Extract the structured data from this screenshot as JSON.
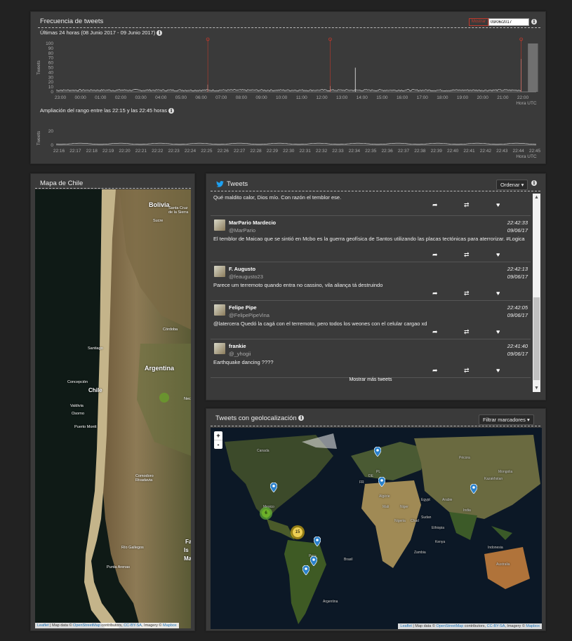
{
  "freq": {
    "title": "Frecuencia de tweets",
    "date_value": "09/06/2017",
    "date_btn": "Mostrar",
    "info": "i",
    "sub24": "Últimas 24 horas (08 Junio 2017 - 09 Junio 2017)",
    "y_ticks": [
      "100",
      "90",
      "80",
      "70",
      "60",
      "50",
      "40",
      "30",
      "20",
      "10",
      "0"
    ],
    "y_label": "Tweets",
    "x_ticks": [
      "23:00",
      "00:00",
      "01:00",
      "02:00",
      "03:00",
      "04:00",
      "05:00",
      "06:00",
      "07:00",
      "08:00",
      "09:00",
      "10:00",
      "11:00",
      "12:00",
      "13:00",
      "14:00",
      "15:00",
      "16:00",
      "17:00",
      "18:00",
      "19:00",
      "20:00",
      "21:00",
      "22:00"
    ],
    "x_unit": "Hora UTC",
    "sub_zoom": "Ampliación del rango entre las 22:15 y las 22:45 horas",
    "zoom_y_ticks": [
      "20",
      "0"
    ],
    "zoom_x_ticks": [
      "22:16",
      "22:17",
      "22:18",
      "22:19",
      "22:20",
      "22:21",
      "22:22",
      "22:23",
      "22:24",
      "22:25",
      "22:26",
      "22:27",
      "22:28",
      "22:29",
      "22:30",
      "22:31",
      "22:32",
      "22:33",
      "22:34",
      "22:35",
      "22:36",
      "22:37",
      "22:38",
      "22:39",
      "22:40",
      "22:41",
      "22:42",
      "22:43",
      "22:44",
      "22:45"
    ],
    "zoom_x_unit": "Hora UTC"
  },
  "chart_data": [
    {
      "type": "line",
      "title": "Últimas 24 horas (08 Junio 2017 - 09 Junio 2017)",
      "ylabel": "Tweets",
      "xlabel": "Hora UTC",
      "ylim": [
        0,
        100
      ],
      "series": [
        {
          "x": [
            "23:00",
            "03:00",
            "04:00",
            "07:00",
            "07:30",
            "08:00",
            "12:00",
            "13:00",
            "13:30",
            "14:00",
            "18:00",
            "21:00",
            "22:00",
            "22:30"
          ],
          "values": [
            2,
            3,
            3,
            2,
            15,
            3,
            3,
            12,
            3,
            3,
            3,
            3,
            68,
            4
          ]
        }
      ],
      "markers": [
        "06:20",
        "12:25",
        "21:55"
      ],
      "highlight_range": [
        "22:15",
        "22:45"
      ]
    },
    {
      "type": "line",
      "title": "Ampliación del rango entre las 22:15 y las 22:45 horas",
      "ylabel": "Tweets",
      "xlabel": "Hora UTC",
      "ylim": [
        0,
        20
      ],
      "series": [
        {
          "x": [
            "22:16",
            "22:22",
            "22:28",
            "22:34",
            "22:40",
            "22:45"
          ],
          "values": [
            2,
            2,
            2,
            2,
            2,
            2
          ]
        }
      ]
    }
  ],
  "chile": {
    "title": "Mapa de Chile",
    "labels": [
      {
        "t": "Bolivia",
        "size": "big"
      },
      {
        "t": "Santa Cruz de la Sierra",
        "size": "small"
      },
      {
        "t": "Sucre",
        "size": "small"
      },
      {
        "t": "Córdoba",
        "size": "small"
      },
      {
        "t": "Santiago",
        "size": "small"
      },
      {
        "t": "Argentina",
        "size": "big"
      },
      {
        "t": "Concepción",
        "size": "small"
      },
      {
        "t": "Chile",
        "size": "med"
      },
      {
        "t": "Valdivia",
        "size": "small"
      },
      {
        "t": "Osorno",
        "size": "small"
      },
      {
        "t": "Puerto Montt",
        "size": "small"
      },
      {
        "t": "Comodoro Rivadavia",
        "size": "small"
      },
      {
        "t": "Río Gallegos",
        "size": "small"
      },
      {
        "t": "Punta Arenas",
        "size": "small"
      },
      {
        "t": "Nec",
        "size": "small"
      },
      {
        "t": "Fa",
        "size": "med"
      },
      {
        "t": "Is",
        "size": "med"
      },
      {
        "t": "Ma",
        "size": "med"
      }
    ],
    "attr_leaflet": "Leaflet",
    "attr_mid": " | Map data © ",
    "attr_osm": "OpenStreetMap",
    "attr_mid2": " contributors, ",
    "attr_cc": "CC-BY-SA",
    "attr_mid3": ", Imagery © ",
    "attr_mapbox": "Mapbox"
  },
  "tweets": {
    "title": "Tweets",
    "sort_btn": "Ordenar",
    "more": "Mostrar más tweets",
    "top_text": "Qué maldito calor, Dios mío. Con razón el temblor ese.",
    "items": [
      {
        "name": "MarPario Mardecio",
        "handle": "@MarPario",
        "time": "22:42:33",
        "date": "09/06/17",
        "text": "El temblor de Maicao que se sintió en Mcbo es la guerra geofísica de Santos utilizando las placas tectónicas para aterrorizar. #Logica"
      },
      {
        "name": "F. Augusto",
        "handle": "@feaugusto23",
        "time": "22:42:13",
        "date": "09/06/17",
        "text": "Parece um terremoto quando entra no cassino, vila aliança tá destruindo"
      },
      {
        "name": "Felipe Pipe",
        "handle": "@FelipePipeVina",
        "time": "22:42:05",
        "date": "09/06/17",
        "text": "@latercera Quedó la cagá con el terremoto, pero todos los weones con el celular cargao xd"
      },
      {
        "name": "frankie",
        "handle": "@_yhogii",
        "time": "22:41:40",
        "date": "09/06/17",
        "text": "Earthquake dancing ????"
      }
    ]
  },
  "geo": {
    "title": "Tweets con geolocalización",
    "filter_btn": "Filtrar marcadores",
    "zoom_in": "+",
    "zoom_out": "-",
    "cluster_a": "6",
    "cluster_b": "15",
    "labels": [
      "Canada",
      "Pécora",
      "Brasil",
      "Argentina",
      "Australia",
      "Indonesia",
      "Kazakhstan",
      "Mongolia",
      "Algérie",
      "Niger",
      "Mali",
      "Nigeria",
      "Egypt",
      "Arabie",
      "India",
      "Peru",
      "Mexico",
      "PL",
      "DE",
      "FR",
      "Chad",
      "Sudan",
      "Ethiopia",
      "Kenya",
      "Zambia"
    ]
  },
  "colors": {
    "accent": "#c0392b",
    "page_bg": "#222222",
    "panel_bg": "#3a3a3a",
    "pin": "#2a81cb"
  }
}
